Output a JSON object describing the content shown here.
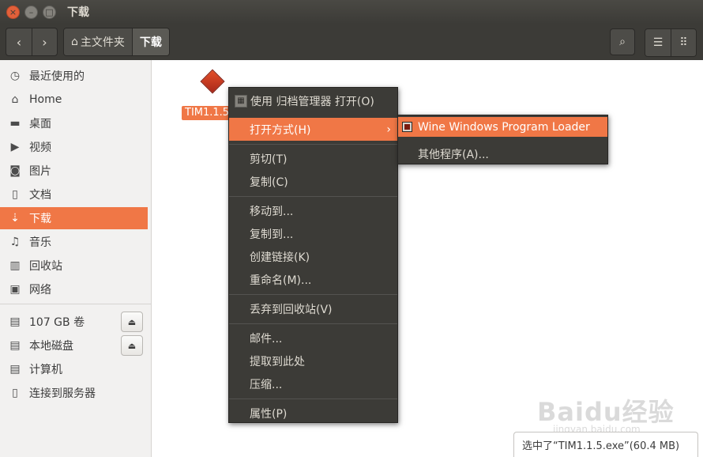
{
  "window": {
    "title": "下载",
    "controls": {
      "close": "×",
      "minimize": "–",
      "maximize": "□"
    }
  },
  "toolbar": {
    "back_icon": "‹",
    "forward_icon": "›",
    "breadcrumbs": [
      {
        "label": "主文件夹",
        "icon": "home-icon"
      },
      {
        "label": "下载"
      }
    ],
    "search_icon": "⌕",
    "list_view_icon": "☰",
    "grid_view_icon": "⠿"
  },
  "sidebar": {
    "items": [
      {
        "label": "最近使用的",
        "icon": "clock-icon",
        "glyph": "◷"
      },
      {
        "label": "Home",
        "icon": "home-icon",
        "glyph": "⌂"
      },
      {
        "label": "桌面",
        "icon": "folder-icon",
        "glyph": "▬"
      },
      {
        "label": "视频",
        "icon": "video-icon",
        "glyph": "▶"
      },
      {
        "label": "图片",
        "icon": "camera-icon",
        "glyph": "◙"
      },
      {
        "label": "文档",
        "icon": "document-icon",
        "glyph": "▯"
      },
      {
        "label": "下载",
        "icon": "download-icon",
        "glyph": "⇣",
        "active": true
      },
      {
        "label": "音乐",
        "icon": "music-icon",
        "glyph": "♫"
      },
      {
        "label": "回收站",
        "icon": "trash-icon",
        "glyph": "▥"
      },
      {
        "label": "网络",
        "icon": "network-icon",
        "glyph": "▣"
      }
    ],
    "devices": [
      {
        "label": "107 GB 卷",
        "icon": "drive-icon",
        "glyph": "▤",
        "eject": true
      },
      {
        "label": "本地磁盘",
        "icon": "drive-icon",
        "glyph": "▤",
        "eject": true
      },
      {
        "label": "计算机",
        "icon": "computer-icon",
        "glyph": "▤"
      },
      {
        "label": "连接到服务器",
        "icon": "server-icon",
        "glyph": "▯"
      }
    ],
    "eject_glyph": "⏏"
  },
  "file": {
    "label": "TIM1.1.5"
  },
  "context_menu": {
    "items": [
      {
        "label": "使用 归档管理器 打开(O)",
        "has_icon": true
      },
      {
        "label": "打开方式(H)",
        "submenu": true,
        "hover": true
      },
      {
        "label": "剪切(T)"
      },
      {
        "label": "复制(C)"
      },
      {
        "label": "移动到..."
      },
      {
        "label": "复制到..."
      },
      {
        "label": "创建链接(K)"
      },
      {
        "label": "重命名(M)..."
      },
      {
        "label": "丢弃到回收站(V)"
      },
      {
        "label": "邮件..."
      },
      {
        "label": "提取到此处"
      },
      {
        "label": "压缩..."
      },
      {
        "label": "属性(P)"
      }
    ],
    "arrow_glyph": "›"
  },
  "submenu": {
    "items": [
      {
        "label": "Wine Windows Program Loader",
        "hover": true
      },
      {
        "label": "其他程序(A)..."
      }
    ]
  },
  "status_bar": {
    "text": "选中了“TIM1.1.5.exe”(60.4 MB)"
  },
  "watermark": {
    "text": "Baidu经验",
    "sub": "jingyan.baidu.com"
  }
}
